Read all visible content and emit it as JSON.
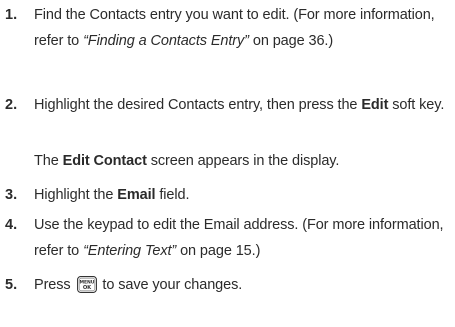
{
  "steps": [
    {
      "number": "1.",
      "text_a": "Find the Contacts entry you want to edit. (For more information, refer to ",
      "link_text": "“Finding a Contacts Entry”",
      "text_b": " on page 36.)"
    },
    {
      "number": "2.",
      "text_a": "Highlight the desired Contacts entry, then press the ",
      "bold": "Edit",
      "text_b": " soft key.",
      "note_bold": "Edit Contact",
      "note_text": " screen appears in the display.",
      "note_prefix": "The "
    },
    {
      "number": "3.",
      "text_a": "Highlight the ",
      "bold": "Email",
      "text_b": " field."
    },
    {
      "number": "4.",
      "text_a": "Use the keypad to edit the Email address. (For more information, refer to ",
      "link_text": "“Entering Text”",
      "text_b": " on page 15.)"
    },
    {
      "number": "5.",
      "text_a": "Press ",
      "key_label": "MENU OK",
      "text_b": " to save your changes."
    }
  ],
  "icons": {
    "menu_ok_key": "menu-ok-key-icon"
  }
}
